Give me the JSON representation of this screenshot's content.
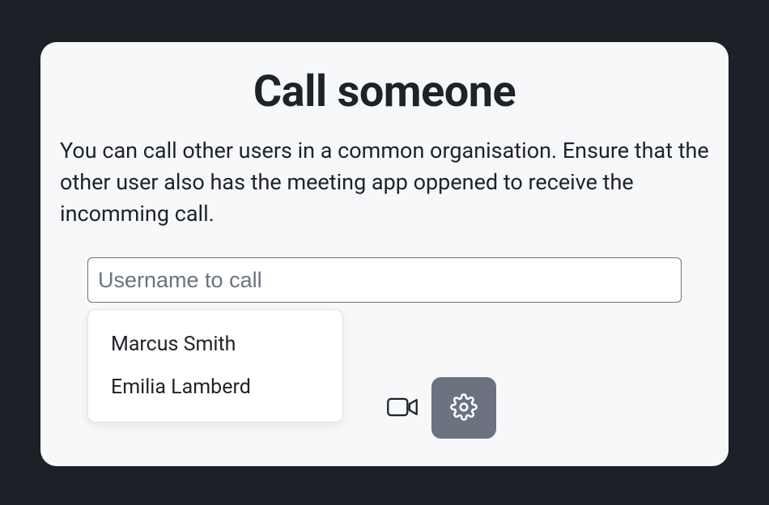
{
  "dialog": {
    "title": "Call someone",
    "description": "You can call other users in a common organisation. Ensure that the other user also has the meeting app oppened to receive the incomming call.",
    "input": {
      "placeholder": "Username to call",
      "value": ""
    },
    "suggestions": [
      "Marcus Smith",
      "Emilia Lamberd"
    ]
  }
}
